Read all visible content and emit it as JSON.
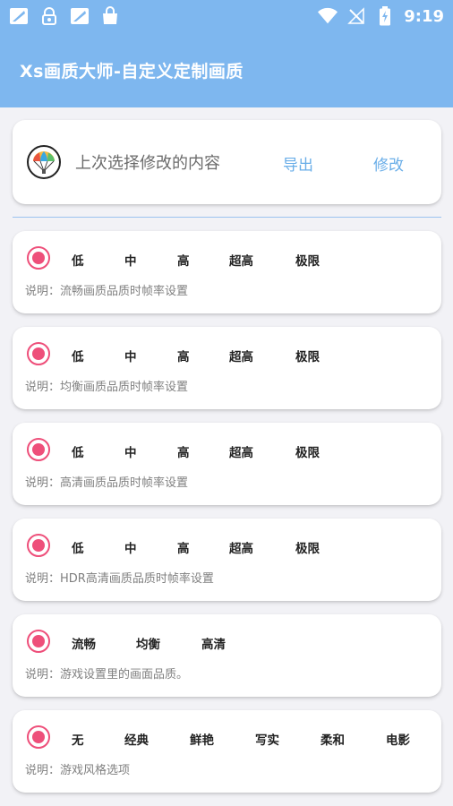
{
  "status_bar": {
    "time": "9:19",
    "left_icons": [
      "app-notification-icon",
      "vpn-key-icon",
      "app-notification-icon",
      "shopping-bag-icon"
    ],
    "right_icons": [
      "wifi-icon",
      "no-signal-icon",
      "battery-charging-icon"
    ]
  },
  "app_bar": {
    "title": "Xs画质大师-自定义定制画质"
  },
  "last_choice": {
    "label": "上次选择修改的内容",
    "export_label": "导出",
    "modify_label": "修改"
  },
  "option_groups": [
    {
      "options": [
        "低",
        "中",
        "高",
        "超高",
        "极限"
      ],
      "description": "说明：流畅画质品质时帧率设置"
    },
    {
      "options": [
        "低",
        "中",
        "高",
        "超高",
        "极限"
      ],
      "description": "说明：均衡画质品质时帧率设置"
    },
    {
      "options": [
        "低",
        "中",
        "高",
        "超高",
        "极限"
      ],
      "description": "说明：高清画质品质时帧率设置"
    },
    {
      "options": [
        "低",
        "中",
        "高",
        "超高",
        "极限"
      ],
      "description": "说明：HDR高清画质品质时帧率设置"
    },
    {
      "options": [
        "流畅",
        "均衡",
        "高清"
      ],
      "description": "说明：游戏设置里的画面品质。"
    },
    {
      "options": [
        "无",
        "经典",
        "鲜艳",
        "写实",
        "柔和",
        "电影"
      ],
      "description": "说明：游戏风格选项"
    }
  ],
  "colors": {
    "app_bar": "#7eb7ef",
    "accent_pink": "#ee4f7a",
    "link_blue": "#6aaee8"
  }
}
